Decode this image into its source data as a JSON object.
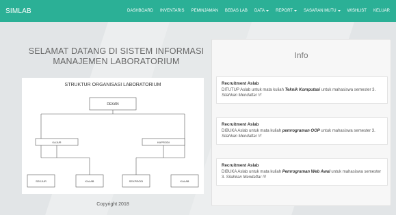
{
  "navbar": {
    "brand": "SIMLAB",
    "items": [
      {
        "label": "DASHBOARD",
        "dropdown": false
      },
      {
        "label": "INVENTARIS",
        "dropdown": false
      },
      {
        "label": "PEMINJAMAN",
        "dropdown": false
      },
      {
        "label": "BEBAS LAB",
        "dropdown": false
      },
      {
        "label": "DATA",
        "dropdown": true
      },
      {
        "label": "REPORT",
        "dropdown": true
      },
      {
        "label": "SASARAN MUTU",
        "dropdown": true
      },
      {
        "label": "WISHLIST",
        "dropdown": false
      },
      {
        "label": "KELUAR",
        "dropdown": false
      }
    ],
    "color": "#2bb096"
  },
  "welcome": {
    "line1": "SELAMAT DATANG DI SISTEM INFORMASI",
    "line2": "MANAJEMEN LABORATORIUM"
  },
  "org_chart": {
    "title": "STRUKTUR ORGANISASI LABORATORIUM",
    "top": "DEKAN",
    "level2": [
      "KAJUR",
      "KAPRODI"
    ],
    "level3": [
      "SEKJUR",
      "KALAB",
      "SEKPRODI",
      "KALAB"
    ]
  },
  "footer": {
    "copyright": "Copyright 2018"
  },
  "info": {
    "title": "Info",
    "cards": [
      {
        "title": "Recruitment Aslab",
        "prefix": "DITUTUP Aslab untuk mata kuliah ",
        "course": "Teknik Komputasi",
        "suffix": " untuk mahasiswa semester 3. ",
        "cta": "Silahkan Mendaftar !!!"
      },
      {
        "title": "Recruitment Aslab",
        "prefix": "DIBUKA Aslab untuk mata kuliah ",
        "course": "pemrograman OOP",
        "suffix": " untuk mahasiswa semester 3. ",
        "cta": "Silahkan Mendaftar !!!"
      },
      {
        "title": "Recruitment Aslab",
        "prefix": "DIBUKA Aslab untuk mata kuliah ",
        "course": "Pemrograman Web Awal",
        "suffix": " untuk mahasiswa semester 3. ",
        "cta": "Silahkan Mendaftar !!!"
      }
    ]
  }
}
